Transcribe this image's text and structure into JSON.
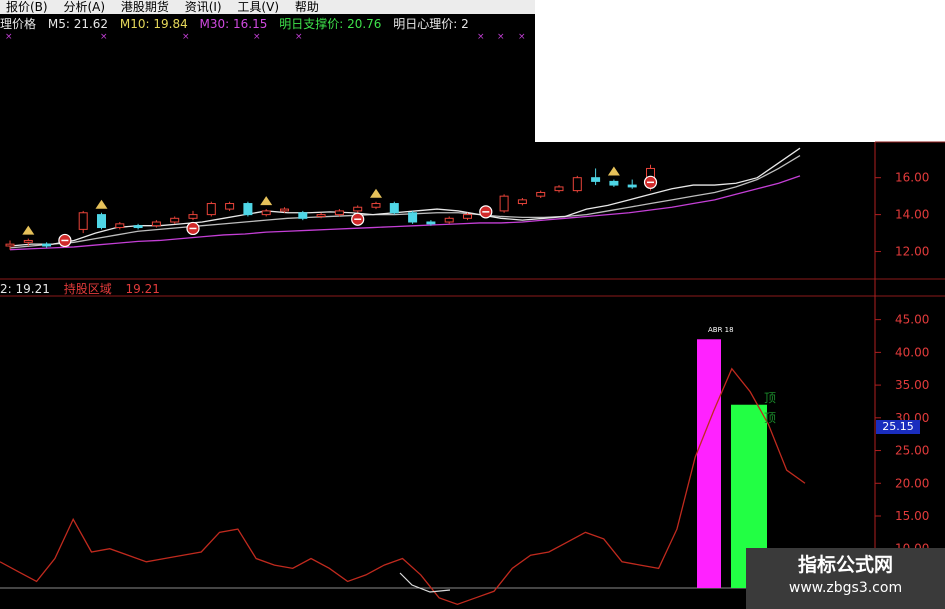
{
  "menu": [
    "报价(B)",
    "分析(A)",
    "港股期货",
    "资讯(I)",
    "工具(V)",
    "帮助"
  ],
  "info_top": {
    "label": "理价格",
    "m5": "M5: 21.62",
    "m10": "M10: 19.84",
    "m30": "M30: 16.15",
    "support": "明日支撑价: 20.76",
    "psych": "明日心理价: 2"
  },
  "info_bottom": {
    "left": "2: 19.21",
    "hold": "持股区域",
    "hold_value": "19.21"
  },
  "bar_labels": {
    "magenta": "ABR 18",
    "green_top": "顶",
    "green_bottom": "顶"
  },
  "current_value": "25.15",
  "watermark": {
    "title": "指标公式网",
    "url": "www.zbgs3.com"
  },
  "colors": {
    "up": "#e8443a",
    "down": "#4fd6e6",
    "ma_magenta": "#c43fd6",
    "magenta_bar": "#ff22ff",
    "green_bar": "#22ff44",
    "oscillator": "#c02a1e"
  },
  "chart_data": [
    {
      "type": "candlestick",
      "title": "",
      "y_ticks": [
        12.0,
        14.0,
        16.0
      ],
      "ylim": [
        11.0,
        17.5
      ],
      "candles": [
        {
          "o": 12.3,
          "c": 12.4,
          "h": 12.6,
          "l": 12.1,
          "up": true
        },
        {
          "o": 12.5,
          "c": 12.6,
          "h": 12.7,
          "l": 12.3,
          "up": true
        },
        {
          "o": 12.4,
          "c": 12.3,
          "h": 12.5,
          "l": 12.2,
          "up": false
        },
        {
          "o": 12.3,
          "c": 12.5,
          "h": 12.6,
          "l": 12.2,
          "up": true
        },
        {
          "o": 13.2,
          "c": 14.1,
          "h": 14.2,
          "l": 13.0,
          "up": true
        },
        {
          "o": 14.0,
          "c": 13.3,
          "h": 14.1,
          "l": 13.2,
          "up": false
        },
        {
          "o": 13.3,
          "c": 13.5,
          "h": 13.6,
          "l": 13.2,
          "up": true
        },
        {
          "o": 13.4,
          "c": 13.3,
          "h": 13.5,
          "l": 13.2,
          "up": false
        },
        {
          "o": 13.4,
          "c": 13.6,
          "h": 13.7,
          "l": 13.3,
          "up": true
        },
        {
          "o": 13.6,
          "c": 13.8,
          "h": 13.9,
          "l": 13.5,
          "up": true
        },
        {
          "o": 13.8,
          "c": 14.0,
          "h": 14.2,
          "l": 13.7,
          "up": true
        },
        {
          "o": 14.0,
          "c": 14.6,
          "h": 14.7,
          "l": 13.9,
          "up": true
        },
        {
          "o": 14.3,
          "c": 14.6,
          "h": 14.7,
          "l": 14.2,
          "up": true
        },
        {
          "o": 14.6,
          "c": 14.0,
          "h": 14.7,
          "l": 13.9,
          "up": false
        },
        {
          "o": 14.0,
          "c": 14.2,
          "h": 14.3,
          "l": 13.9,
          "up": true
        },
        {
          "o": 14.2,
          "c": 14.3,
          "h": 14.4,
          "l": 14.1,
          "up": true
        },
        {
          "o": 14.1,
          "c": 13.8,
          "h": 14.2,
          "l": 13.7,
          "up": false
        },
        {
          "o": 13.9,
          "c": 14.0,
          "h": 14.1,
          "l": 13.8,
          "up": true
        },
        {
          "o": 14.0,
          "c": 14.2,
          "h": 14.3,
          "l": 13.9,
          "up": true
        },
        {
          "o": 14.2,
          "c": 14.4,
          "h": 14.5,
          "l": 14.1,
          "up": true
        },
        {
          "o": 14.4,
          "c": 14.6,
          "h": 14.7,
          "l": 14.3,
          "up": true
        },
        {
          "o": 14.6,
          "c": 14.1,
          "h": 14.7,
          "l": 14.0,
          "up": false
        },
        {
          "o": 14.1,
          "c": 13.6,
          "h": 14.2,
          "l": 13.5,
          "up": false
        },
        {
          "o": 13.6,
          "c": 13.5,
          "h": 13.7,
          "l": 13.4,
          "up": false
        },
        {
          "o": 13.6,
          "c": 13.8,
          "h": 13.9,
          "l": 13.5,
          "up": true
        },
        {
          "o": 13.8,
          "c": 14.0,
          "h": 14.1,
          "l": 13.7,
          "up": true
        },
        {
          "o": 14.0,
          "c": 14.2,
          "h": 14.3,
          "l": 13.9,
          "up": true
        },
        {
          "o": 14.2,
          "c": 15.0,
          "h": 15.1,
          "l": 14.1,
          "up": true
        },
        {
          "o": 14.6,
          "c": 14.8,
          "h": 14.9,
          "l": 14.5,
          "up": true
        },
        {
          "o": 15.0,
          "c": 15.2,
          "h": 15.3,
          "l": 14.9,
          "up": true
        },
        {
          "o": 15.3,
          "c": 15.5,
          "h": 15.6,
          "l": 15.2,
          "up": true
        },
        {
          "o": 15.3,
          "c": 16.0,
          "h": 16.1,
          "l": 15.2,
          "up": true
        },
        {
          "o": 16.0,
          "c": 15.8,
          "h": 16.5,
          "l": 15.6,
          "up": false
        },
        {
          "o": 15.8,
          "c": 15.6,
          "h": 15.9,
          "l": 15.5,
          "up": false
        },
        {
          "o": 15.6,
          "c": 15.5,
          "h": 15.9,
          "l": 15.4,
          "up": false
        },
        {
          "o": 15.5,
          "c": 16.5,
          "h": 16.7,
          "l": 15.3,
          "up": true
        }
      ],
      "ma_lines": {
        "magenta": [
          12.1,
          12.15,
          12.2,
          12.25,
          12.35,
          12.45,
          12.55,
          12.6,
          12.7,
          12.8,
          12.9,
          12.95,
          13.05,
          13.1,
          13.15,
          13.2,
          13.25,
          13.3,
          13.35,
          13.4,
          13.45,
          13.5,
          13.55,
          13.55,
          13.6,
          13.7,
          13.8,
          13.9,
          14.0,
          14.1,
          14.25,
          14.4,
          14.6,
          14.8,
          15.1,
          15.4,
          15.7,
          16.1
        ],
        "white_slow": [
          12.2,
          12.3,
          12.4,
          12.5,
          12.7,
          12.9,
          13.1,
          13.2,
          13.3,
          13.4,
          13.5,
          13.6,
          13.7,
          13.8,
          13.85,
          13.9,
          13.95,
          14.0,
          14.0,
          14.05,
          14.1,
          14.1,
          14.0,
          13.9,
          13.85,
          13.85,
          13.9,
          14.0,
          14.2,
          14.4,
          14.6,
          14.8,
          15.0,
          15.2,
          15.5,
          15.9,
          16.5,
          17.2
        ],
        "white_fast": [
          12.3,
          12.4,
          12.4,
          12.6,
          13.0,
          13.3,
          13.4,
          13.4,
          13.5,
          13.6,
          13.8,
          14.0,
          14.2,
          14.1,
          14.1,
          14.15,
          14.1,
          14.0,
          14.1,
          14.2,
          14.3,
          14.2,
          14.0,
          13.8,
          13.7,
          13.8,
          13.9,
          14.3,
          14.5,
          14.8,
          15.1,
          15.4,
          15.6,
          15.6,
          15.7,
          16.0,
          16.8,
          17.6
        ]
      }
    },
    {
      "type": "line",
      "title": "",
      "y_ticks": [
        10.0,
        15.0,
        20.0,
        25.0,
        30.0,
        35.0,
        40.0,
        45.0
      ],
      "ylim": [
        4.0,
        48.0
      ],
      "series": [
        {
          "values": [
            8.0,
            6.5,
            5.0,
            8.5,
            14.5,
            9.5,
            10.0,
            9.0,
            8.0,
            8.5,
            9.0,
            9.5,
            12.5,
            13.0,
            8.5,
            7.5,
            7.0,
            8.5,
            7.0,
            5.0,
            6.0,
            7.5,
            8.5,
            6.0,
            2.5,
            1.5,
            2.5,
            3.5,
            7.0,
            9.0,
            9.5,
            11.0,
            12.5,
            11.5,
            8.0,
            7.5,
            7.0,
            13.0,
            24.0,
            31.0,
            37.5,
            34.0,
            29.0,
            22.0,
            20.0
          ]
        }
      ],
      "bars": [
        {
          "color": "magenta",
          "value": 42.0
        },
        {
          "color": "green",
          "value": 32.0
        }
      ]
    }
  ]
}
